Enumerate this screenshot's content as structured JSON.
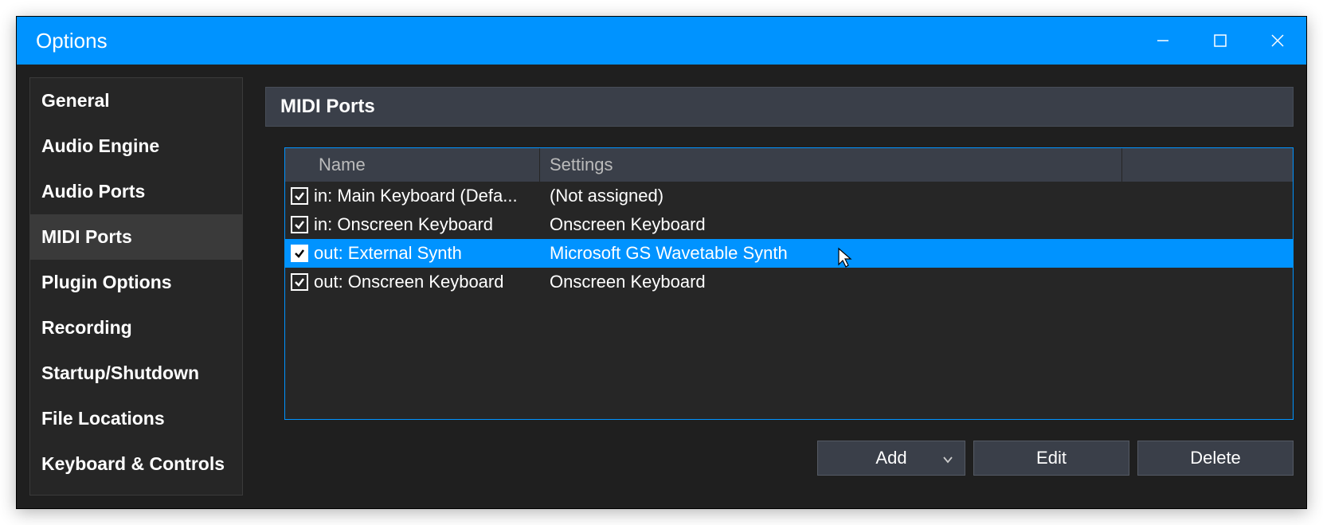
{
  "window": {
    "title": "Options"
  },
  "sidebar": {
    "items": [
      {
        "label": "General"
      },
      {
        "label": "Audio Engine"
      },
      {
        "label": "Audio Ports"
      },
      {
        "label": "MIDI Ports",
        "active": true
      },
      {
        "label": "Plugin Options"
      },
      {
        "label": "Recording"
      },
      {
        "label": "Startup/Shutdown"
      },
      {
        "label": "File Locations"
      },
      {
        "label": "Keyboard & Controls"
      }
    ]
  },
  "section": {
    "title": "MIDI Ports"
  },
  "table": {
    "columns": {
      "name": "Name",
      "settings": "Settings"
    },
    "rows": [
      {
        "checked": true,
        "name": "in: Main Keyboard (Defa...",
        "settings": "(Not assigned)"
      },
      {
        "checked": true,
        "name": "in: Onscreen Keyboard",
        "settings": "Onscreen Keyboard"
      },
      {
        "checked": true,
        "name": "out: External Synth",
        "settings": "Microsoft GS Wavetable Synth",
        "selected": true
      },
      {
        "checked": true,
        "name": "out: Onscreen Keyboard",
        "settings": "Onscreen Keyboard"
      }
    ]
  },
  "buttons": {
    "add": "Add",
    "edit": "Edit",
    "delete": "Delete"
  }
}
